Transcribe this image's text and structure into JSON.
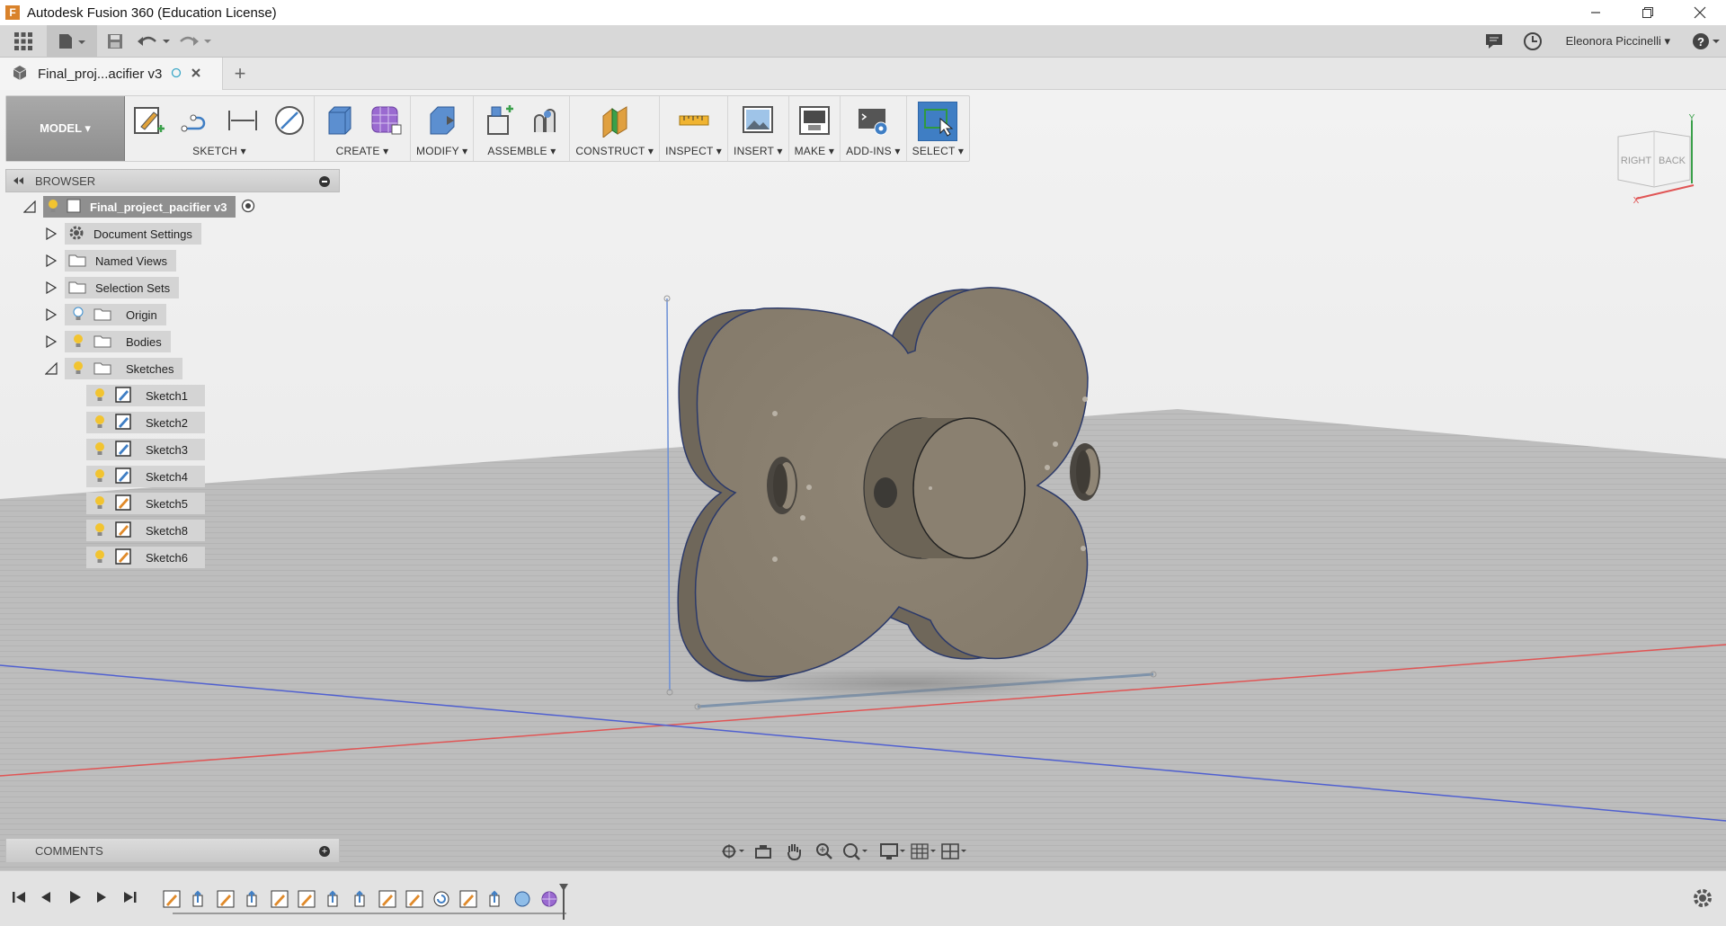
{
  "window": {
    "title": "Autodesk Fusion 360 (Education License)",
    "controls": [
      "minimize-icon",
      "restore-icon",
      "close-icon"
    ]
  },
  "quickbar": {
    "user_name": "Eleonora Piccinelli ▾"
  },
  "document_tab": {
    "name": "Final_proj...acifier v3",
    "new_tab_symbol": "+"
  },
  "toolbar": {
    "workspace": "MODEL ▾",
    "groups": [
      {
        "label": "SKETCH ▾",
        "icons": [
          "create-sketch-icon",
          "line-icon",
          "dimension-icon",
          "circle-icon"
        ]
      },
      {
        "label": "CREATE ▾",
        "icons": [
          "extrude-icon",
          "form-icon"
        ]
      },
      {
        "label": "MODIFY ▾",
        "icons": [
          "press-pull-icon"
        ]
      },
      {
        "label": "ASSEMBLE ▾",
        "icons": [
          "new-component-icon",
          "joint-icon"
        ]
      },
      {
        "label": "CONSTRUCT ▾",
        "icons": [
          "offset-plane-icon"
        ]
      },
      {
        "label": "INSPECT ▾",
        "icons": [
          "measure-icon"
        ]
      },
      {
        "label": "INSERT ▾",
        "icons": [
          "insert-image-icon"
        ]
      },
      {
        "label": "MAKE ▾",
        "icons": [
          "print-3d-icon"
        ]
      },
      {
        "label": "ADD-INS ▾",
        "icons": [
          "scripts-icon"
        ]
      },
      {
        "label": "SELECT ▾",
        "icons": [
          "select-icon"
        ]
      }
    ]
  },
  "browser": {
    "title": "BROWSER",
    "root": "Final_project_pacifier v3",
    "items": [
      {
        "label": "Document Settings",
        "icon": "gear-icon"
      },
      {
        "label": "Named Views",
        "icon": "folder-icon"
      },
      {
        "label": "Selection Sets",
        "icon": "folder-icon"
      },
      {
        "label": "Origin",
        "icon": "folder-icon",
        "bulb": "off"
      },
      {
        "label": "Bodies",
        "icon": "folder-icon",
        "bulb": "on"
      },
      {
        "label": "Sketches",
        "icon": "folder-icon",
        "bulb": "on",
        "expanded": true
      }
    ],
    "sketches": [
      "Sketch1",
      "Sketch2",
      "Sketch3",
      "Sketch4",
      "Sketch5",
      "Sketch8",
      "Sketch6"
    ]
  },
  "comments": {
    "title": "COMMENTS"
  },
  "viewcube": {
    "faces": [
      "RIGHT",
      "BACK"
    ],
    "axes": [
      "Y",
      "X"
    ]
  },
  "colors": {
    "accent": "#3f7ec4",
    "body": "#8a8070",
    "x_axis": "#e05555",
    "z_axis": "#5060d0"
  }
}
